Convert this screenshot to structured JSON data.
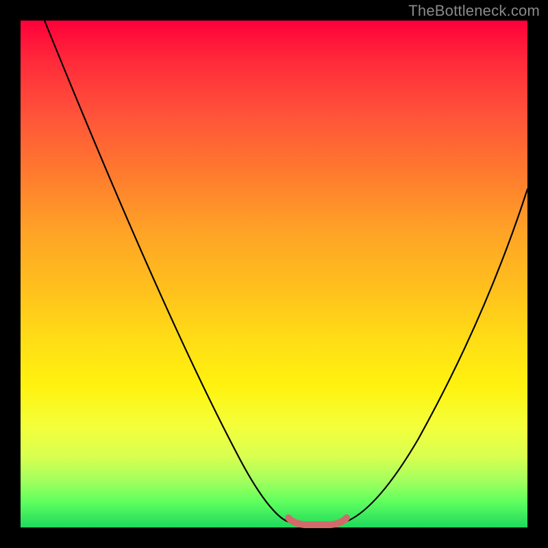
{
  "watermark": "TheBottleneck.com",
  "chart_data": {
    "type": "line",
    "title": "",
    "xlabel": "",
    "ylabel": "",
    "ylim": [
      0,
      100
    ],
    "xlim": [
      0,
      100
    ],
    "legend": false,
    "grid": false,
    "annotations": [],
    "series": [
      {
        "name": "left-curve",
        "x": [
          5,
          10,
          15,
          20,
          25,
          30,
          35,
          40,
          45,
          50,
          53
        ],
        "values": [
          100,
          89,
          78,
          67,
          56,
          46,
          36,
          26,
          17,
          6,
          1
        ]
      },
      {
        "name": "right-curve",
        "x": [
          64,
          68,
          73,
          78,
          83,
          88,
          93,
          98,
          100
        ],
        "values": [
          1,
          5,
          12,
          21,
          31,
          41,
          52,
          62,
          67
        ]
      },
      {
        "name": "bottom-highlight",
        "x": [
          53,
          55,
          58,
          61,
          64
        ],
        "values": [
          1.2,
          0.6,
          0.4,
          0.6,
          1.2
        ]
      }
    ],
    "colors": {
      "curve": "#000000",
      "highlight": "#d36a6a",
      "gradient_top": "#ff003a",
      "gradient_bottom": "#1fd85e"
    }
  }
}
